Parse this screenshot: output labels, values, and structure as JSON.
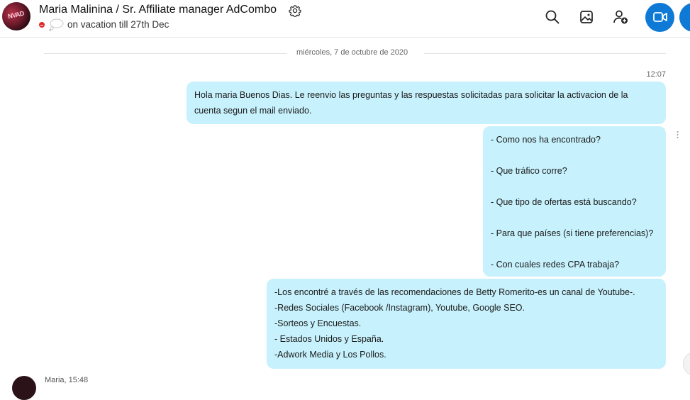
{
  "header": {
    "avatar_text": "NVAD",
    "title": "Maria Malinina / Sr. Affiliate manager AdCombo",
    "mood": "on vacation till 27th Dec",
    "icons": [
      "gear-icon",
      "search-icon",
      "gallery-icon",
      "add-person-icon",
      "video-call-icon",
      "audio-call-icon"
    ],
    "accent_color": "#0f7ad6",
    "status_color": "#e02a2a"
  },
  "conversation": {
    "date_divider": "miércoles, 7 de octubre de 2020",
    "messages": [
      {
        "time": "12:07",
        "lines": [
          "Hola maria Buenos Dias. Le reenvio las preguntas y las respuestas solicitadas para solicitar la activacion de la",
          "cuenta segun el mail enviado."
        ]
      },
      {
        "lines": [
          "- Como nos ha encontrado?",
          "- Que tráfico corre?",
          "- Que tipo de ofertas está buscando?",
          "- Para que países (si tiene preferencias)?",
          "- Con cuales redes CPA trabaja?"
        ]
      },
      {
        "lines": [
          "-Los encontré a través de las recomendaciones de Betty Romerito-es un canal de Youtube-.",
          "-Redes Sociales (Facebook /Instagram), Youtube, Google SEO.",
          "-Sorteos y Encuestas.",
          "- Estados Unidos y España.",
          "-Adwork Media y Los Pollos."
        ]
      }
    ],
    "bubble_color": "#c7f1fc",
    "next_sender": "Maria, 15:48"
  }
}
